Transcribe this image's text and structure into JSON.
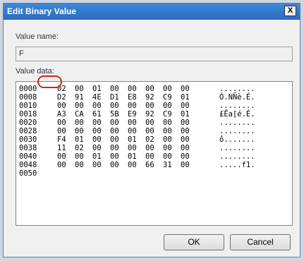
{
  "window": {
    "title": "Edit Binary Value",
    "close_label": "X"
  },
  "value_name": {
    "label": "Value name:",
    "value": "F"
  },
  "value_data": {
    "label": "Value data:",
    "rows": [
      {
        "addr": "0000",
        "bytes": [
          "02",
          "00",
          "01",
          "00",
          "00",
          "00",
          "00",
          "00"
        ],
        "ascii": "........"
      },
      {
        "addr": "0008",
        "bytes": [
          "D2",
          "91",
          "4E",
          "D1",
          "E8",
          "92",
          "C9",
          "01"
        ],
        "ascii": "Ò.NÑè.É."
      },
      {
        "addr": "0010",
        "bytes": [
          "00",
          "00",
          "00",
          "00",
          "00",
          "00",
          "00",
          "00"
        ],
        "ascii": "........"
      },
      {
        "addr": "0018",
        "bytes": [
          "A3",
          "CA",
          "61",
          "5B",
          "E9",
          "92",
          "C9",
          "01"
        ],
        "ascii": "£Êa[é.É."
      },
      {
        "addr": "0020",
        "bytes": [
          "00",
          "00",
          "00",
          "00",
          "00",
          "00",
          "00",
          "00"
        ],
        "ascii": "........"
      },
      {
        "addr": "0028",
        "bytes": [
          "00",
          "00",
          "00",
          "00",
          "00",
          "00",
          "00",
          "00"
        ],
        "ascii": "........"
      },
      {
        "addr": "0030",
        "bytes": [
          "F4",
          "01",
          "00",
          "00",
          "01",
          "02",
          "00",
          "00"
        ],
        "ascii": "ô......."
      },
      {
        "addr": "0038",
        "bytes": [
          "11",
          "02",
          "00",
          "00",
          "00",
          "00",
          "00",
          "00"
        ],
        "ascii": "........"
      },
      {
        "addr": "0040",
        "bytes": [
          "00",
          "00",
          "01",
          "00",
          "01",
          "00",
          "00",
          "00"
        ],
        "ascii": "........"
      },
      {
        "addr": "0048",
        "bytes": [
          "00",
          "00",
          "00",
          "00",
          "00",
          "66",
          "31",
          "00"
        ],
        "ascii": ".....f1."
      },
      {
        "addr": "0050",
        "bytes": [],
        "ascii": ""
      }
    ],
    "highlighted": {
      "row": 7,
      "byte": 0,
      "color": "#d22222"
    }
  },
  "buttons": {
    "ok": "OK",
    "cancel": "Cancel"
  }
}
